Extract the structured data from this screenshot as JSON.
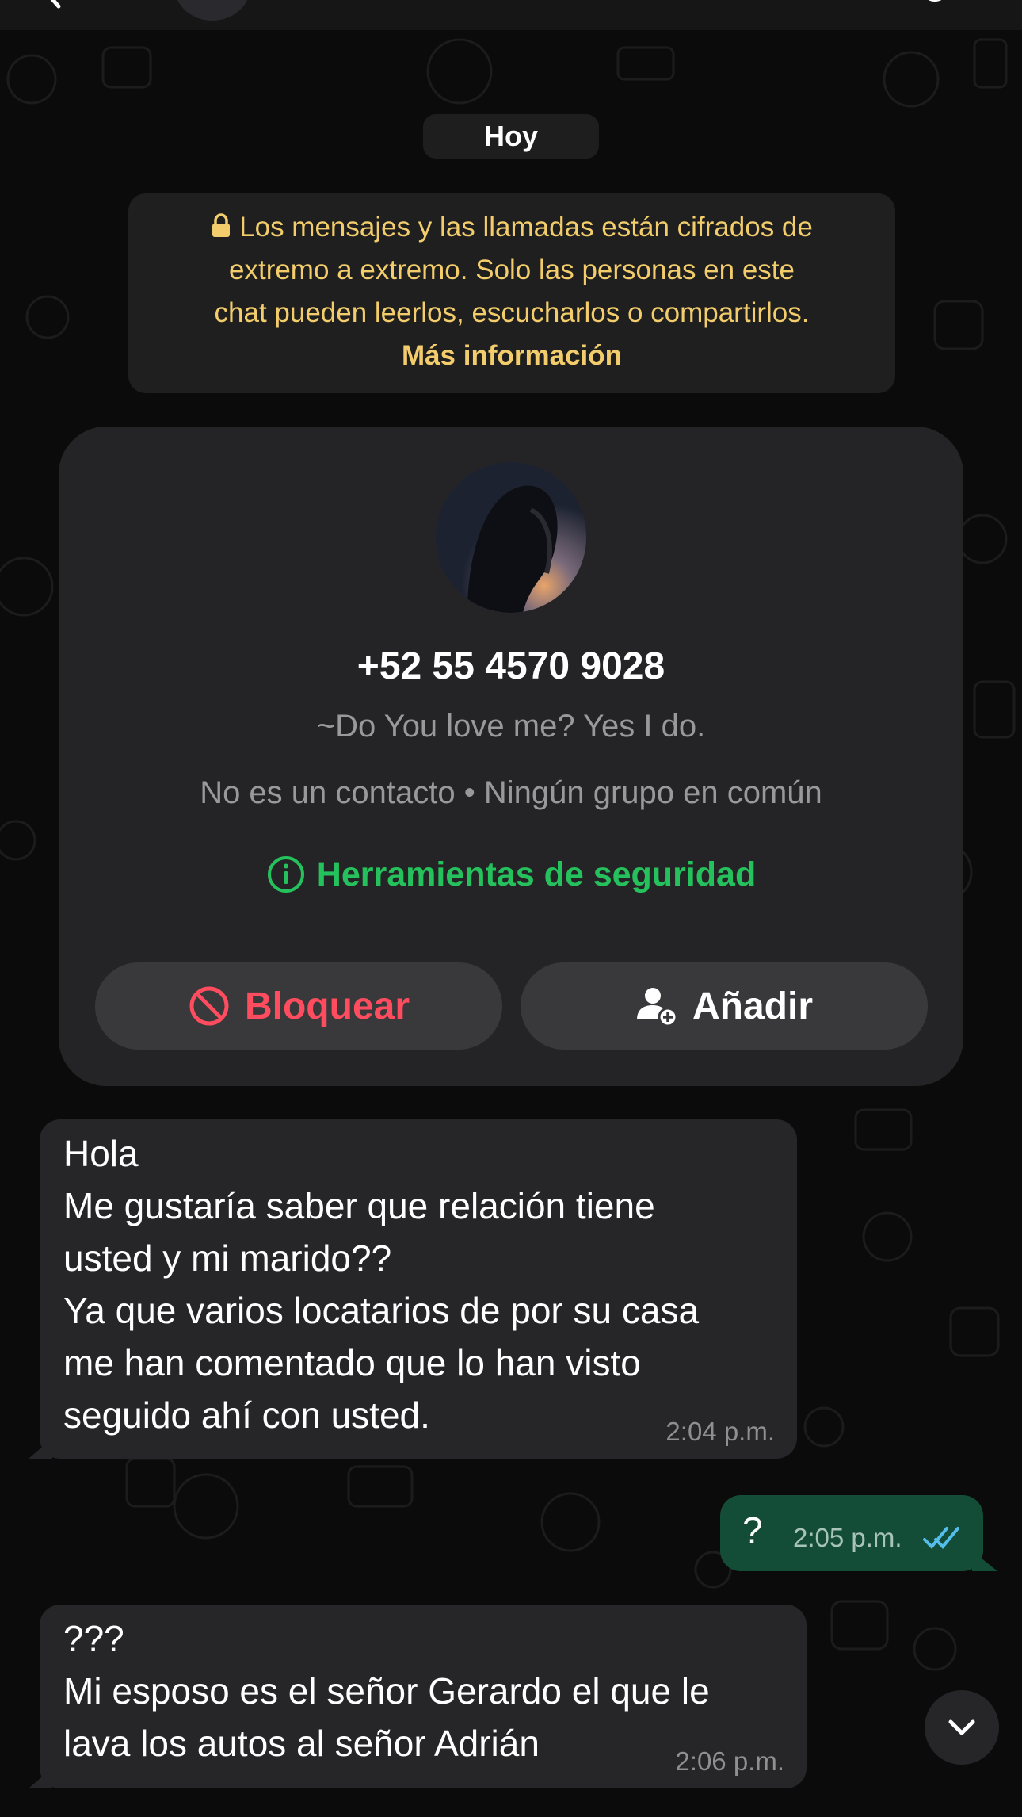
{
  "chat": {
    "date_label": "Hoy",
    "encryption": {
      "lines": [
        "Los mensajes y las llamadas están cifrados de",
        "extremo a extremo. Solo las personas en este",
        "chat pueden leerlos, escucharlos o compartirlos."
      ],
      "more_info": "Más información"
    },
    "contact_card": {
      "phone": "+52 55 4570 9028",
      "status": "~Do You love me? Yes I do.",
      "info": "No es un contacto • Ningún grupo en común",
      "safety_tools": "Herramientas de seguridad",
      "block_label": "Bloquear",
      "add_label": "Añadir"
    },
    "messages": [
      {
        "direction": "incoming",
        "lines": [
          "Hola",
          "Me gustaría saber que relación tiene",
          "usted y mi marido??",
          "Ya que varios locatarios de por su casa",
          "me han comentado que lo han visto",
          "seguido ahí con usted."
        ],
        "time": "2:04 p.m."
      },
      {
        "direction": "outgoing",
        "text": "?",
        "time": "2:05 p.m.",
        "status": "read"
      },
      {
        "direction": "incoming",
        "lines": [
          "???",
          "Mi esposo es el señor Gerardo el que le",
          "lava los autos al señor Adrián"
        ],
        "time": "2:06 p.m."
      }
    ]
  },
  "colors": {
    "background": "#0b0b0b",
    "incoming_bubble": "#262628",
    "outgoing_bubble": "#144d37",
    "encryption_text": "#f3cd6b",
    "safety_green": "#25c15c",
    "block_red": "#ff4d5f",
    "read_ticks": "#53bdeb"
  },
  "icons": [
    "lock-icon",
    "info-icon",
    "block-icon",
    "add-contact-icon",
    "double-check-icon",
    "chevron-down-icon",
    "back-icon",
    "call-icon"
  ]
}
